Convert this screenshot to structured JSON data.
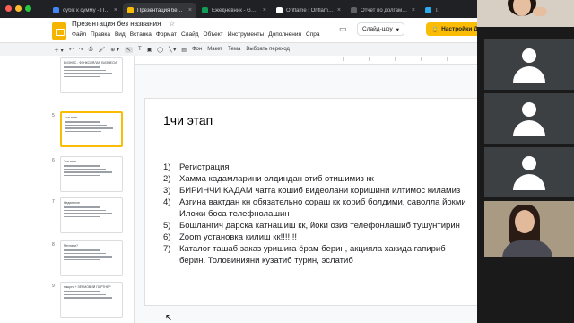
{
  "browser": {
    "tabs": [
      {
        "title": "субік к сумму - Поис",
        "favicon_color": "#4285f4",
        "active": false
      },
      {
        "title": "Презентация без наз",
        "favicon_color": "#fbbc04",
        "active": true
      },
      {
        "title": "Ежедневник - Google",
        "favicon_color": "#0f9d58",
        "active": false
      },
      {
        "title": "Oriflame | Oriflame Cos",
        "favicon_color": "#ffffff",
        "active": false
      },
      {
        "title": "Отчет по долгам | Orif",
        "favicon_color": "#5f6368",
        "active": false
      },
      {
        "title": "Tel",
        "favicon_color": "#2aabee",
        "active": false
      }
    ]
  },
  "docs": {
    "title": "Презентация без названия",
    "menu": [
      "Файл",
      "Правка",
      "Вид",
      "Вставка",
      "Формат",
      "Слайд",
      "Объект",
      "Инструменты",
      "Дополнения",
      "Спра"
    ],
    "slideshow_label": "Слайд-шоу",
    "settings_label": "Настройки До",
    "toolbar": {
      "bg_label": "Фон",
      "layout_label": "Макет",
      "theme_label": "Тема",
      "transition_label": "Выбрать переход"
    },
    "accent_color": "#fbbc04"
  },
  "filmstrip": [
    {
      "num": "",
      "lines": [
        "БИЗНЕС - ФУНКСИЯЛАР БИЗНЕСИ"
      ],
      "selected": false
    },
    {
      "num": "5",
      "lines": [
        "1чи этап"
      ],
      "selected": true
    },
    {
      "num": "6",
      "lines": [
        "2чи этап"
      ],
      "selected": false
    },
    {
      "num": "7",
      "lines": [
        "Недельное"
      ],
      "selected": false
    },
    {
      "num": "8",
      "lines": [
        "Мечтани?"
      ],
      "selected": false
    },
    {
      "num": "9",
      "lines": [
        "тишрги + ЗЁРМОВИЙ ПАРТНЕР"
      ],
      "selected": false
    }
  ],
  "slide": {
    "title": "1чи этап",
    "steps": [
      {
        "num": "1)",
        "text": "Регистрация"
      },
      {
        "num": "2)",
        "text": "Хамма кадамларини олдиндан этиб отишимиз кк"
      },
      {
        "num": "3)",
        "text": "БИРИНЧИ КАДАМ чатга кошиб видеолани коришини илтимос киламиз"
      },
      {
        "num": "4)",
        "text": "Азгина вактдан кн обязательно сораш кк кориб болдими, саволла йокми\nИложи боса телефнолашин"
      },
      {
        "num": "5)",
        "text": "Бошлангич дарска катнашиш кк, йоки озиз телефонлашиб тушунтирин"
      },
      {
        "num": "6)",
        "text": "Zoom установка килиш кк!!!!!!!"
      },
      {
        "num": "7)",
        "text": "Каталог ташаб заказ уришига ёрам берин, акцияла хакида гапириб\nберин. Толовинияни кузатиб турин, эслатиб"
      }
    ]
  }
}
